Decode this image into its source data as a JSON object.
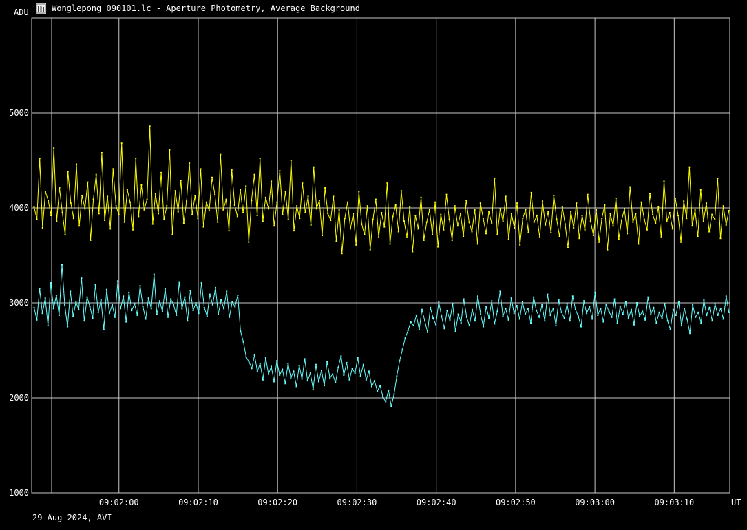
{
  "window": {
    "title": "Wonglepong 090101.lc - Aperture Photometry, Average Background",
    "icon": "vertical-bars-app-icon"
  },
  "footer": {
    "text": "29 Aug 2024, AVI"
  },
  "colors": {
    "background": "#000000",
    "grid": "#c8c8c8",
    "series_a": "#ffff00",
    "series_b": "#66ffff"
  },
  "chart_data": {
    "type": "line",
    "ylabel": "ADU",
    "xlabel": "UT",
    "ylim": [
      1000,
      6000
    ],
    "yticks": [
      1000,
      2000,
      3000,
      4000,
      5000
    ],
    "xlim_seconds": [
      109.0,
      197.0
    ],
    "x_reference_time": "09:00:00",
    "xticks": [
      "09:02:00",
      "09:02:10",
      "09:02:20",
      "09:02:30",
      "09:02:40",
      "09:02:50",
      "09:03:00",
      "09:03:10"
    ],
    "grid": true,
    "series": [
      {
        "color": "#ffff00",
        "x_start": "09:01:49.3",
        "x_end": "09:03:16.9",
        "values": [
          4010,
          3880,
          4520,
          3790,
          4170,
          4080,
          3920,
          4630,
          3860,
          4210,
          3950,
          3720,
          4380,
          4050,
          3890,
          4460,
          3810,
          4130,
          3990,
          4270,
          3660,
          4090,
          4350,
          3940,
          4580,
          3870,
          4120,
          3780,
          4410,
          4020,
          3930,
          4680,
          3850,
          4190,
          4060,
          3770,
          4520,
          3910,
          4240,
          3980,
          4090,
          4860,
          3830,
          4150,
          3940,
          4370,
          3880,
          4020,
          4610,
          3720,
          4180,
          3960,
          4290,
          3840,
          4070,
          4470,
          3930,
          4130,
          3890,
          4410,
          3800,
          4060,
          3970,
          4320,
          4140,
          3850,
          4560,
          3980,
          4090,
          3760,
          4400,
          4030,
          3910,
          4190,
          3950,
          4230,
          3640,
          4080,
          4350,
          3920,
          4520,
          3860,
          4110,
          3990,
          4280,
          3810,
          4060,
          4390,
          3930,
          4170,
          3880,
          4500,
          3760,
          4020,
          3890,
          4260,
          3950,
          4120,
          3820,
          4430,
          3990,
          4080,
          3710,
          4210,
          3940,
          3870,
          4120,
          3650,
          3980,
          3520,
          3890,
          4060,
          3780,
          3940,
          3610,
          4170,
          3830,
          3720,
          4020,
          3560,
          3880,
          4090,
          3690,
          3950,
          3800,
          4260,
          3620,
          3910,
          4030,
          3750,
          4180,
          3860,
          3690,
          4010,
          3540,
          3920,
          3780,
          4110,
          3660,
          3850,
          3980,
          3720,
          4060,
          3590,
          3930,
          3770,
          4140,
          3880,
          3660,
          4020,
          3810,
          3940,
          3700,
          4080,
          3850,
          3750,
          3980,
          3620,
          4050,
          3890,
          3730,
          3960,
          3840,
          4310,
          3720,
          3990,
          3860,
          4120,
          3670,
          3940,
          3790,
          4050,
          3610,
          3890,
          3980,
          3740,
          4160,
          3850,
          3920,
          3690,
          4070,
          3820,
          3960,
          3740,
          4130,
          3880,
          3700,
          4010,
          3830,
          3580,
          3960,
          3790,
          4050,
          3680,
          3920,
          3770,
          4140,
          3860,
          3710,
          3980,
          3640,
          3890,
          4030,
          3560,
          3940,
          3810,
          4100,
          3670,
          3870,
          3990,
          3730,
          4220,
          3850,
          3940,
          3620,
          4060,
          3880,
          3770,
          4150,
          3930,
          3840,
          4010,
          3690,
          4280,
          3860,
          3950,
          3780,
          4100,
          3920,
          3640,
          4070,
          3890,
          4430,
          3810,
          3980,
          3700,
          4190,
          3860,
          4050,
          3750,
          3930,
          3880,
          4310,
          3680,
          4020,
          3820,
          3970
        ]
      },
      {
        "color": "#66ffff",
        "x_start": "09:01:49.3",
        "x_end": "09:03:16.9",
        "values": [
          2950,
          2820,
          3150,
          2890,
          3050,
          2760,
          3210,
          2940,
          3080,
          2870,
          3400,
          2980,
          2750,
          3120,
          2860,
          3010,
          2930,
          3260,
          2810,
          3060,
          2960,
          2840,
          3190,
          2900,
          3030,
          2720,
          3140,
          2890,
          2980,
          2850,
          3230,
          2940,
          3070,
          2800,
          3110,
          2920,
          2990,
          2870,
          3180,
          2960,
          2830,
          3050,
          2940,
          3300,
          2880,
          3020,
          2910,
          3150,
          2850,
          3040,
          2980,
          2870,
          3220,
          2940,
          3060,
          2810,
          3130,
          2920,
          3000,
          2890,
          3210,
          2950,
          2860,
          3090,
          2980,
          3160,
          2880,
          3030,
          2940,
          3120,
          2850,
          3010,
          2960,
          3080,
          2700,
          2590,
          2430,
          2380,
          2310,
          2450,
          2280,
          2360,
          2190,
          2420,
          2250,
          2330,
          2170,
          2390,
          2240,
          2300,
          2150,
          2360,
          2210,
          2280,
          2120,
          2340,
          2200,
          2410,
          2180,
          2260,
          2090,
          2350,
          2170,
          2290,
          2130,
          2380,
          2210,
          2250,
          2160,
          2320,
          2440,
          2240,
          2370,
          2190,
          2310,
          2260,
          2420,
          2230,
          2350,
          2190,
          2280,
          2120,
          2180,
          2070,
          2130,
          2010,
          1960,
          2080,
          1910,
          2040,
          2230,
          2390,
          2510,
          2630,
          2710,
          2800,
          2760,
          2870,
          2720,
          2930,
          2810,
          2690,
          2950,
          2840,
          2770,
          3010,
          2860,
          2730,
          2920,
          2820,
          2990,
          2700,
          2880,
          2790,
          3040,
          2850,
          2760,
          2930,
          2810,
          3070,
          2880,
          2750,
          2960,
          2840,
          3020,
          2780,
          2910,
          3120,
          2860,
          2940,
          2820,
          3050,
          2890,
          2970,
          2830,
          3010,
          2880,
          2940,
          2790,
          3060,
          2920,
          2850,
          2980,
          2810,
          3090,
          2870,
          2940,
          2760,
          3030,
          2900,
          2840,
          2990,
          2810,
          3070,
          2930,
          2860,
          2750,
          3020,
          2890,
          2960,
          2830,
          3110,
          2870,
          2940,
          2800,
          2980,
          2910,
          2850,
          3040,
          2790,
          2960,
          2880,
          3010,
          2840,
          2930,
          2770,
          3000,
          2860,
          2910,
          2820,
          3060,
          2880,
          2950,
          2790,
          2900,
          2840,
          2990,
          2810,
          2720,
          2930,
          2870,
          3010,
          2760,
          2940,
          2830,
          2680,
          2980,
          2850,
          2900,
          2790,
          3030,
          2870,
          2950,
          2810,
          2990,
          2870,
          2940,
          2830,
          3070,
          2900
        ]
      }
    ]
  }
}
